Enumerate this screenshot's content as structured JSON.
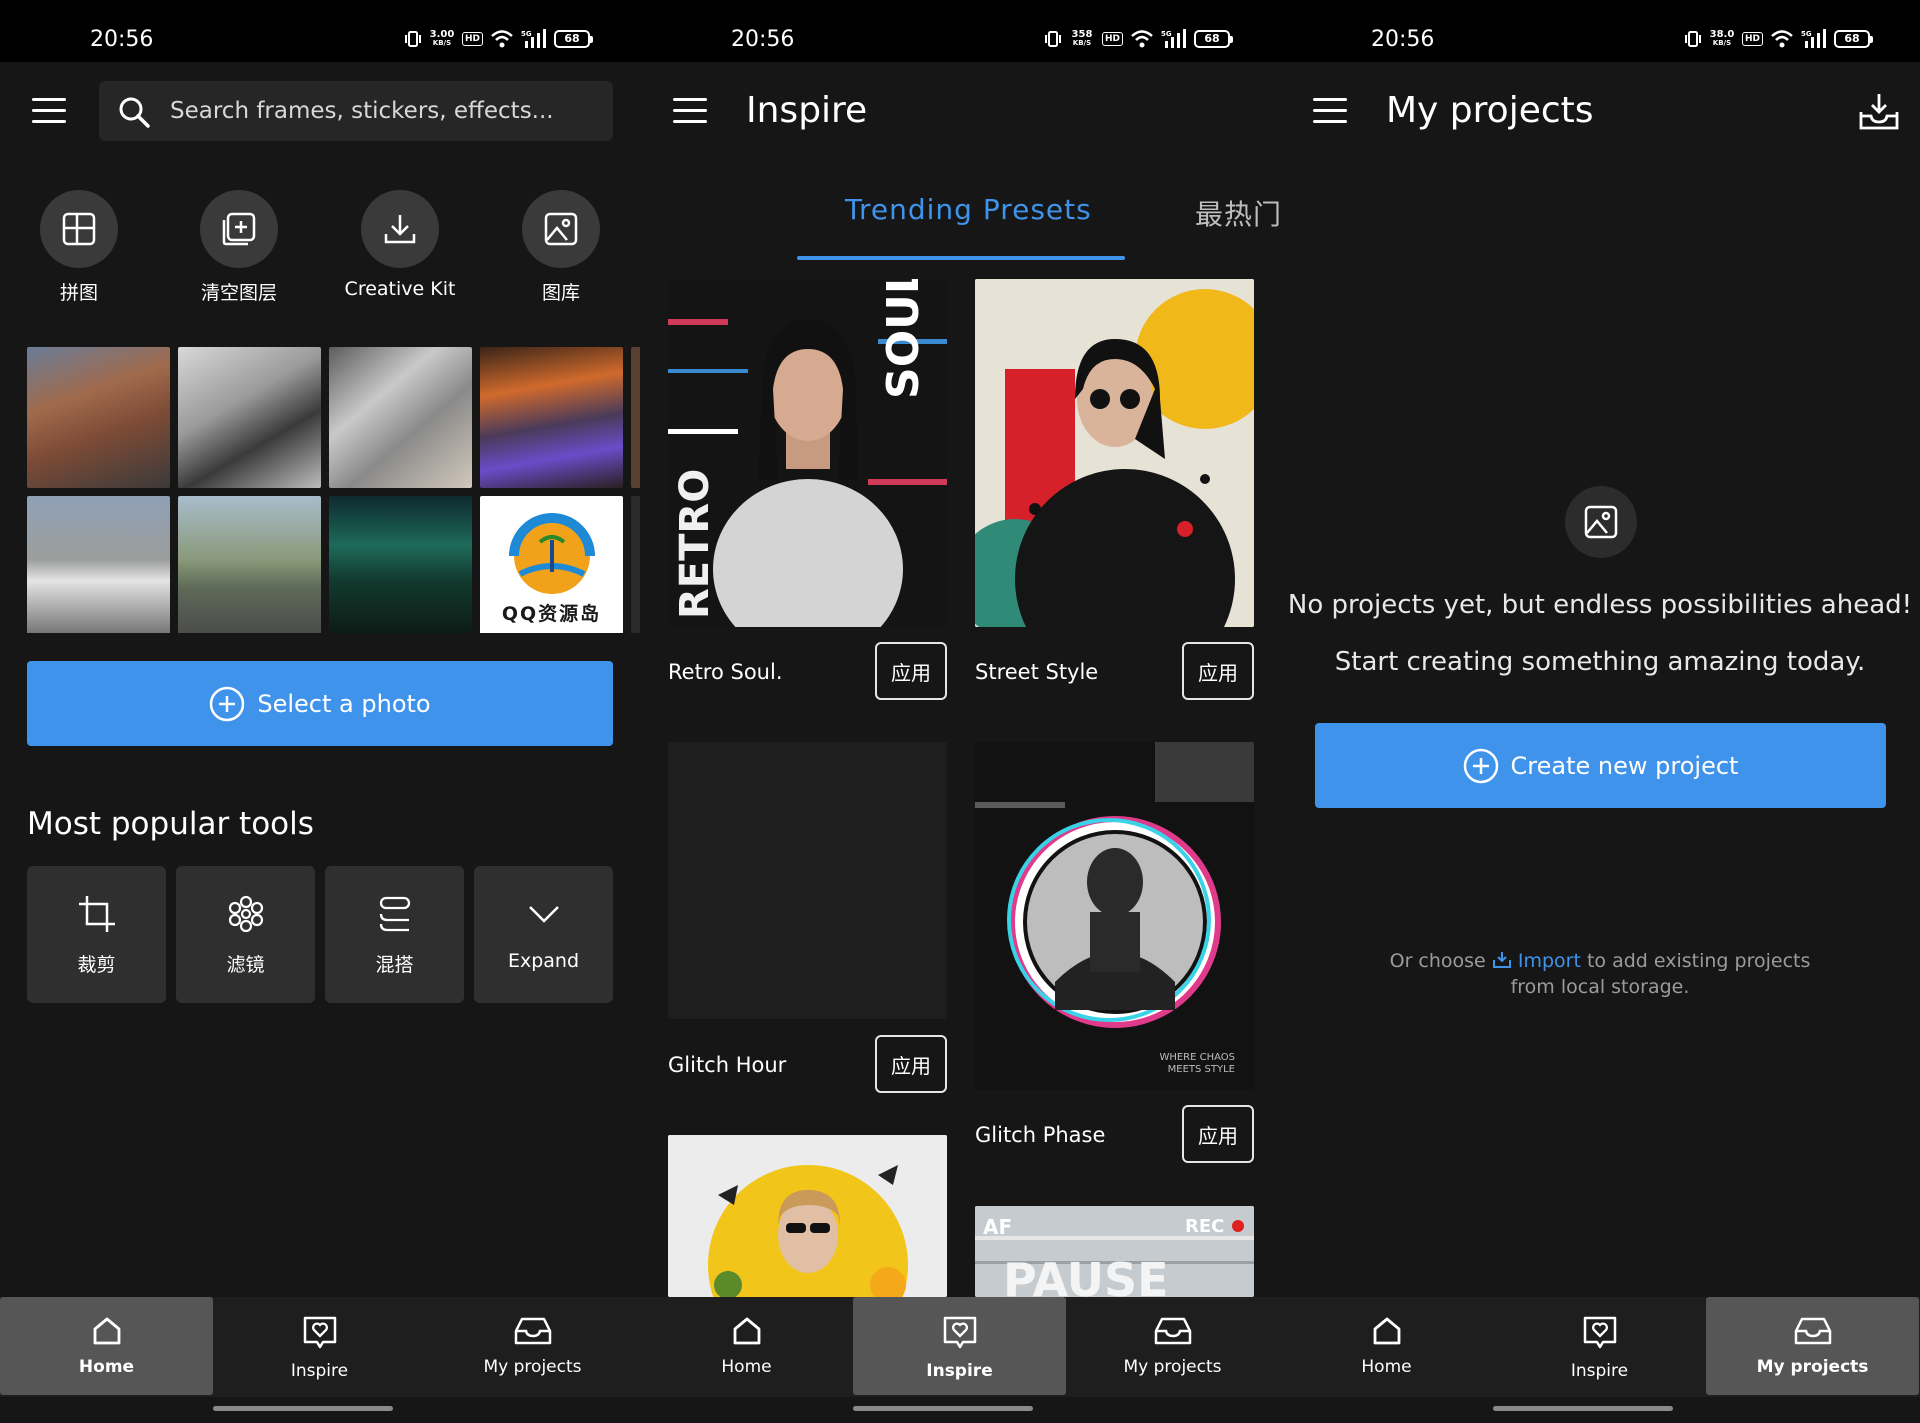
{
  "status_bar": {
    "time": "20:56",
    "panels": [
      {
        "speed_value": "3.00",
        "speed_unit": "KB/S",
        "hd": "HD",
        "net": "5G",
        "battery": "68"
      },
      {
        "speed_value": "358",
        "speed_unit": "KB/S",
        "hd": "HD",
        "net": "5G",
        "battery": "68"
      },
      {
        "speed_value": "38.0",
        "speed_unit": "KB/S",
        "hd": "HD",
        "net": "5G",
        "battery": "68"
      }
    ]
  },
  "home": {
    "search_placeholder": "Search frames, stickers, effects...",
    "quick_actions": [
      {
        "label": "拼图",
        "icon": "collage-icon"
      },
      {
        "label": "清空图层",
        "icon": "add-layer-icon"
      },
      {
        "label": "Creative Kit",
        "icon": "download-icon"
      },
      {
        "label": "图库",
        "icon": "gallery-icon"
      }
    ],
    "thumb_watermark": "QQ资源岛",
    "select_photo_label": "Select a photo",
    "section_title": "Most popular tools",
    "tools": [
      {
        "label": "裁剪",
        "icon": "crop-icon"
      },
      {
        "label": "滤镜",
        "icon": "filter-icon"
      },
      {
        "label": "混搭",
        "icon": "layers-icon"
      },
      {
        "label": "Expand",
        "icon": "chevron-down-icon"
      }
    ]
  },
  "inspire": {
    "title": "Inspire",
    "tabs": [
      {
        "label": "Trending Presets",
        "active": true
      },
      {
        "label": "最热门",
        "active": false
      }
    ],
    "presets": [
      {
        "name": "Retro Soul.",
        "apply": "应用",
        "art_text_1": "SOUL",
        "art_text_2": "RETRO"
      },
      {
        "name": "Street Style",
        "apply": "应用"
      },
      {
        "name": "Glitch Hour",
        "apply": "应用"
      },
      {
        "name": "Glitch Phase",
        "apply": "应用",
        "art_caption_1": "WHERE CHAOS",
        "art_caption_2": "MEETS STYLE"
      }
    ],
    "partial_card_text": {
      "af": "AF",
      "rec": "REC",
      "pause": "PAUSE"
    }
  },
  "projects": {
    "title": "My projects",
    "empty_line1": "No projects yet, but endless possibilities ahead!",
    "empty_line2": "Start creating something amazing today.",
    "create_label": "Create new project",
    "import_prefix": "Or choose",
    "import_link": "Import",
    "import_suffix": "to add existing projects",
    "import_line2": "from local storage."
  },
  "nav": {
    "items": [
      {
        "label": "Home",
        "icon": "home-icon"
      },
      {
        "label": "Inspire",
        "icon": "heart-chat-icon"
      },
      {
        "label": "My projects",
        "icon": "tray-icon"
      }
    ],
    "active_by_panel": [
      "Home",
      "Inspire",
      "My projects"
    ]
  },
  "colors": {
    "accent": "#3f93ea",
    "background": "#161616",
    "card": "#2f2f2f",
    "nav_active": "#565656"
  }
}
